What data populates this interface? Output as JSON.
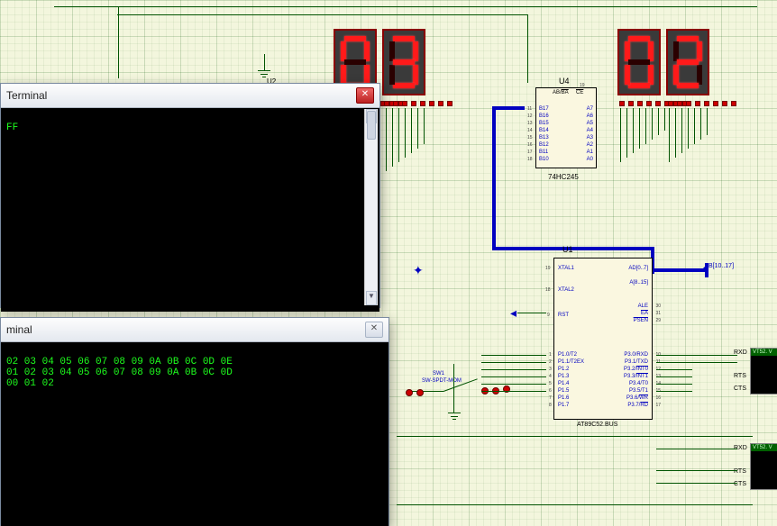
{
  "displays": {
    "d1": {
      "digit": "0",
      "segments": "abcdef"
    },
    "d2": {
      "digit": "3",
      "segments": "abcdg"
    },
    "d3": {
      "digit": "0",
      "segments": "abcdef"
    },
    "d4": {
      "digit": "2",
      "segments": "abdeg"
    }
  },
  "chips": {
    "u4": {
      "ref": "U4",
      "part": "74HC245",
      "left_pins": [
        "B17",
        "B16",
        "B15",
        "B14",
        "B13",
        "B12",
        "B11",
        "B10"
      ],
      "left_nums": [
        "11",
        "12",
        "13",
        "14",
        "15",
        "16",
        "17",
        "18"
      ],
      "right_pins": [
        "A7",
        "A6",
        "A5",
        "A4",
        "A3",
        "A2",
        "A1",
        "A0"
      ],
      "right_nums": [
        "",
        "",
        "",
        "",
        "",
        "",
        "",
        ""
      ],
      "top_pins": [
        "AB/BA",
        "CE"
      ],
      "top_nums": [
        "",
        "19"
      ]
    },
    "u2": {
      "ref": "U2"
    },
    "u1": {
      "ref": "U1",
      "part": "AT89C52.BUS",
      "left_pins_a": [
        "XTAL1",
        "XTAL2"
      ],
      "left_nums_a": [
        "19",
        "18"
      ],
      "left_pins_rst": [
        "RST"
      ],
      "left_nums_rst": [
        "9"
      ],
      "left_pins_p1": [
        "P1.0/T2",
        "P1.1/T2EX",
        "P1.2",
        "P1.3",
        "P1.4",
        "P1.5",
        "P1.6",
        "P1.7"
      ],
      "left_nums_p1": [
        "1",
        "2",
        "3",
        "4",
        "5",
        "6",
        "7",
        "8"
      ],
      "right_pins_bus": [
        "AD[0..7]",
        "A[8..15]"
      ],
      "right_pins_ctl": [
        "ALE",
        "EA",
        "PSEN"
      ],
      "right_nums_ctl": [
        "30",
        "31",
        "29"
      ],
      "right_pins_p3": [
        "P3.0/RXD",
        "P3.1/TXD",
        "P3.2/INT0",
        "P3.3/INT1",
        "P3.4/T0",
        "P3.5/T1",
        "P3.6/WR",
        "P3.7/RD"
      ],
      "right_nums_p3": [
        "10",
        "11",
        "12",
        "13",
        "14",
        "15",
        "16",
        "17"
      ],
      "bus_label": "B[10..17]"
    }
  },
  "switch": {
    "ref": "SW1",
    "part": "SW-SPDT-MOM"
  },
  "terminals": {
    "t1": {
      "title": "Terminal",
      "lines": [
        "FF"
      ]
    },
    "t2": {
      "title": "minal",
      "lines": [
        "02 03 04 05 06 07 08 09 0A 0B 0C 0D 0E",
        "01 02 03 04 05 06 07 08 09 0A 0B 0C 0D",
        "00 01 02"
      ]
    }
  },
  "uart": {
    "labels": [
      "RXD",
      "RTS",
      "CTS"
    ],
    "header": "VT52. V"
  }
}
